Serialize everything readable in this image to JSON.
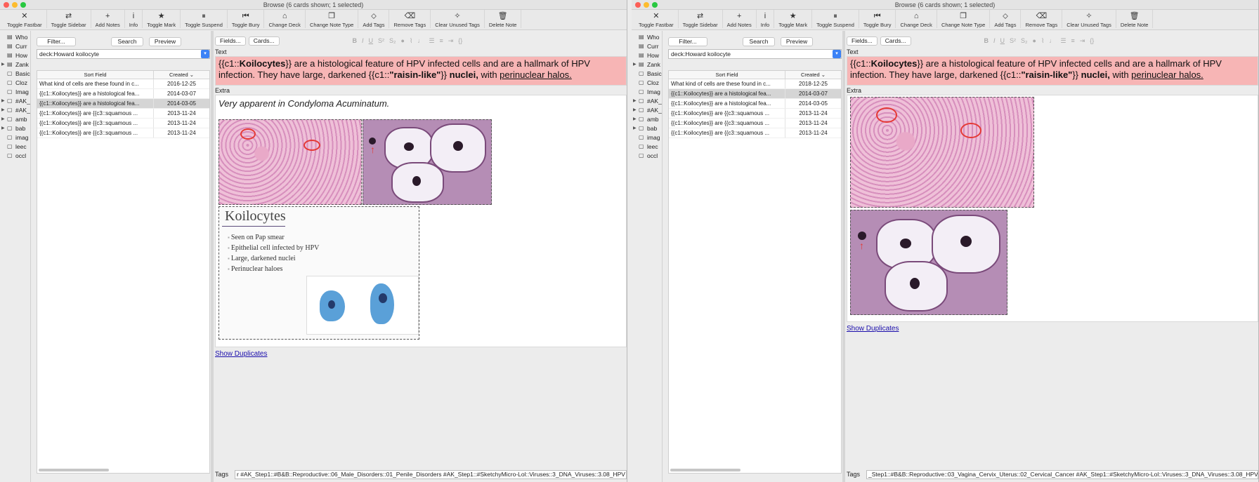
{
  "left": {
    "title": "Browse (6 cards shown; 1 selected)",
    "toolbar": [
      {
        "icon": "✕",
        "icon_name": "close-circle-icon",
        "label": "Toggle Fastbar"
      },
      {
        "icon": "⇄",
        "icon_name": "swap-icon",
        "label": "Toggle Sidebar"
      },
      {
        "icon": "+",
        "icon_name": "plus-icon",
        "label": "Add Notes"
      },
      {
        "icon": "i",
        "icon_name": "info-icon",
        "label": "Info"
      },
      {
        "icon": "★",
        "icon_name": "star-icon",
        "label": "Toggle Mark"
      },
      {
        "icon": "⏸",
        "icon_name": "pause-icon",
        "label": "Toggle Suspend"
      },
      {
        "icon": "⏮",
        "icon_name": "bury-icon",
        "label": "Toggle Bury"
      },
      {
        "icon": "⌂",
        "icon_name": "tray-icon",
        "label": "Change Deck"
      },
      {
        "icon": "❐",
        "icon_name": "book-icon",
        "label": "Change Note Type"
      },
      {
        "icon": "⬦",
        "icon_name": "tag-icon",
        "label": "Add Tags"
      },
      {
        "icon": "⌫",
        "icon_name": "eraser-icon",
        "label": "Remove Tags"
      },
      {
        "icon": "✧",
        "icon_name": "wand-icon",
        "label": "Clear Unused Tags"
      },
      {
        "icon": "🗑",
        "icon_name": "trash-icon",
        "label": "Delete Note"
      }
    ],
    "sidebar": [
      "Who",
      "Curr",
      "How",
      "Zank",
      "Basic",
      "Cloz",
      "Imag",
      "#AK_",
      "#AK_",
      "amb",
      "bab",
      "imag",
      "leec",
      "occl"
    ],
    "buttons": {
      "filter": "Filter...",
      "search": "Search",
      "preview": "Preview",
      "fields": "Fields...",
      "cards": "Cards..."
    },
    "deck_query": "deck:Howard koilocyte",
    "columns": {
      "sort_field": "Sort Field",
      "created": "Created"
    },
    "rows": [
      {
        "field": "What kind of cells are these found in c...",
        "created": "2016-12-25"
      },
      {
        "field": "{{c1::Koilocytes}} are a histological fea...",
        "created": "2014-03-07"
      },
      {
        "field": "{{c1::Koilocytes}} are a histological fea...",
        "created": "2014-03-05"
      },
      {
        "field": "{{c1::Koilocytes}} are {{c3::squamous ...",
        "created": "2013-11-24"
      },
      {
        "field": "{{c1::Koilocytes}} are {{c3::squamous ...",
        "created": "2013-11-24"
      },
      {
        "field": "{{c1::Koilocytes}} are {{c3::squamous ...",
        "created": "2013-11-24"
      }
    ],
    "text_label": "Text",
    "text_parts": {
      "a": "{{c1::",
      "b": "Koilocytes",
      "c": "}} are a histological feature of HPV infected cells and are a hallmark of HPV infection. They have large, darkened {{c1::",
      "d": "\"raisin-like\"",
      "e": "}} ",
      "f": "nuclei,",
      "g": " with ",
      "h": "perinuclear halos."
    },
    "extra_label": "Extra",
    "extra_italic": "Very apparent in Condyloma Acuminatum.",
    "slide": {
      "title": "Koilocytes",
      "bullets": [
        "Seen on Pap smear",
        "Epithelial cell infected by HPV",
        "Large, darkened nuclei",
        "Perinuclear haloes"
      ]
    },
    "show_duplicates": "Show Duplicates",
    "tags_label": "Tags",
    "tags_value": "r #AK_Step1::#B&B::Reproductive::06_Male_Disorders::01_Penile_Disorders #AK_Step1::#SketchyMicro-Lol::Viruses::3_DNA_Viruses::3.08_HPV"
  },
  "right": {
    "title": "Browse (6 cards shown; 1 selected)",
    "sidebar": [
      "Who",
      "Curr",
      "How",
      "Zank",
      "Basic",
      "Cloz",
      "Imag",
      "#AK_",
      "#AK_",
      "amb",
      "bab",
      "imag",
      "leec",
      "occl"
    ],
    "deck_query": "deck:Howard koilocyte",
    "rows": [
      {
        "field": "What kind of cells are these found in c...",
        "created": "2018-12-25"
      },
      {
        "field": "{{c1::Koilocytes}} are a histological fea...",
        "created": "2014-03-07"
      },
      {
        "field": "{{c1::Koilocytes}} are a histological fea...",
        "created": "2014-03-05"
      },
      {
        "field": "{{c1::Koilocytes}} are {{c3::squamous ...",
        "created": "2013-11-24"
      },
      {
        "field": "{{c1::Koilocytes}} are {{c3::squamous ...",
        "created": "2013-11-24"
      },
      {
        "field": "{{c1::Koilocytes}} are {{c3::squamous ...",
        "created": "2013-11-24"
      }
    ],
    "show_duplicates": "Show Duplicates",
    "tags_value": "_Step1::#B&B::Reproductive::03_Vagina_Cervix_Uterus::02_Cervical_Cancer #AK_Step1::#SketchyMicro-Lol::Viruses::3_DNA_Viruses::3.08_HPV"
  }
}
